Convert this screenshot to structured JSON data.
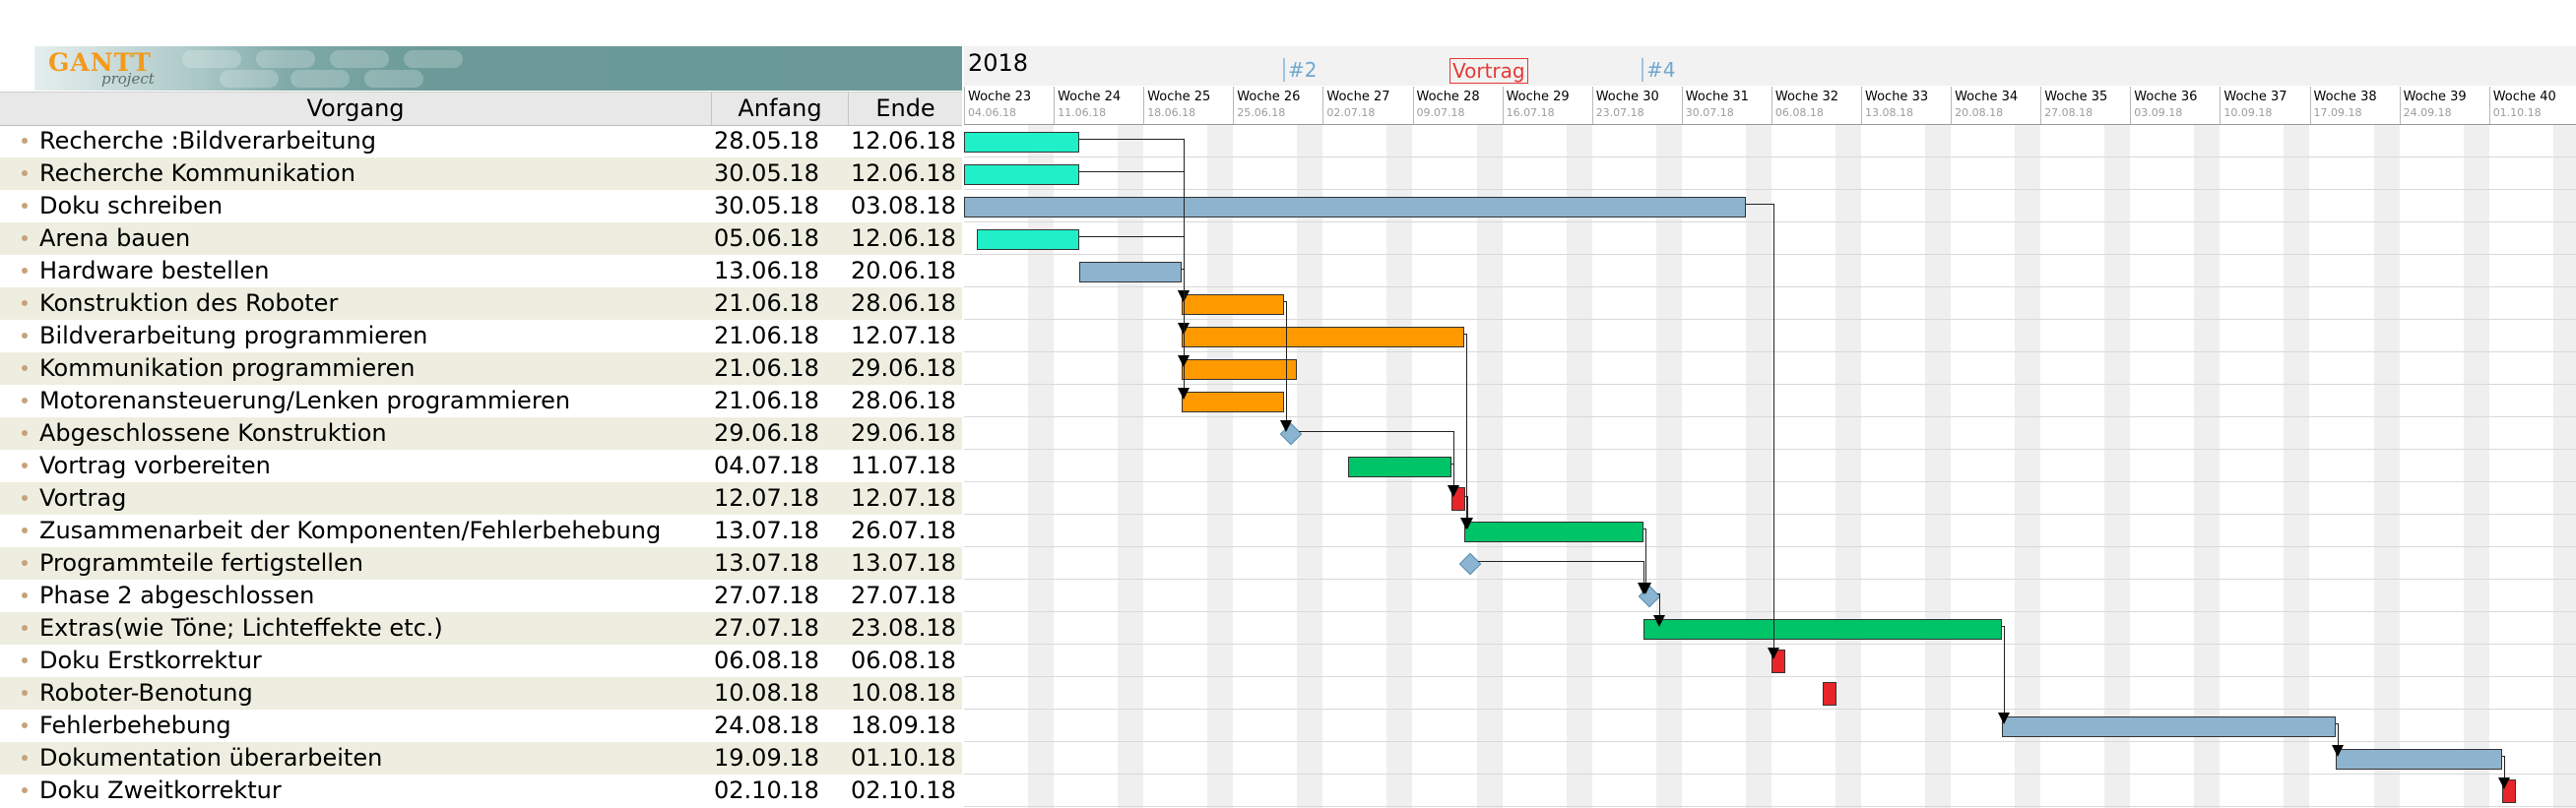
{
  "logo": {
    "text": "GANTT",
    "sub": "project"
  },
  "table": {
    "headers": {
      "name": "Vorgang",
      "start": "Anfang",
      "end": "Ende"
    },
    "tasks": [
      {
        "name": "Recherche :Bildverarbeitung",
        "start": "28.05.18",
        "end": "12.06.18"
      },
      {
        "name": "Recherche Kommunikation",
        "start": "30.05.18",
        "end": "12.06.18"
      },
      {
        "name": "Doku schreiben",
        "start": "30.05.18",
        "end": "03.08.18"
      },
      {
        "name": "Arena bauen",
        "start": "05.06.18",
        "end": "12.06.18"
      },
      {
        "name": "Hardware bestellen",
        "start": "13.06.18",
        "end": "20.06.18"
      },
      {
        "name": "Konstruktion des Roboter",
        "start": "21.06.18",
        "end": "28.06.18"
      },
      {
        "name": "Bildverarbeitung programmieren",
        "start": "21.06.18",
        "end": "12.07.18"
      },
      {
        "name": "Kommunikation programmieren",
        "start": "21.06.18",
        "end": "29.06.18"
      },
      {
        "name": "Motorenansteuerung/Lenken programmieren",
        "start": "21.06.18",
        "end": "28.06.18"
      },
      {
        "name": "Abgeschlossene Konstruktion",
        "start": "29.06.18",
        "end": "29.06.18"
      },
      {
        "name": "Vortrag vorbereiten",
        "start": "04.07.18",
        "end": "11.07.18"
      },
      {
        "name": "Vortrag",
        "start": "12.07.18",
        "end": "12.07.18"
      },
      {
        "name": "Zusammenarbeit der Komponenten/Fehlerbehebung",
        "start": "13.07.18",
        "end": "26.07.18"
      },
      {
        "name": "Programmteile fertigstellen",
        "start": "13.07.18",
        "end": "13.07.18"
      },
      {
        "name": "Phase 2 abgeschlossen",
        "start": "27.07.18",
        "end": "27.07.18"
      },
      {
        "name": "Extras(wie Töne; Lichteffekte etc.)",
        "start": "27.07.18",
        "end": "23.08.18"
      },
      {
        "name": "Doku  Erstkorrektur",
        "start": "06.08.18",
        "end": "06.08.18"
      },
      {
        "name": "Roboter-Benotung",
        "start": "10.08.18",
        "end": "10.08.18"
      },
      {
        "name": "Fehlerbehebung",
        "start": "24.08.18",
        "end": "18.09.18"
      },
      {
        "name": "Dokumentation überarbeiten",
        "start": "19.09.18",
        "end": "01.10.18"
      },
      {
        "name": "Doku Zweitkorrektur",
        "start": "02.10.18",
        "end": "02.10.18"
      }
    ]
  },
  "chart": {
    "year": "2018",
    "markers": [
      {
        "label": "#2",
        "color": "#6fa7cf",
        "box": "#9ec3df"
      },
      {
        "label": "Vortrag",
        "color": "#e53935",
        "box": "#e53935"
      },
      {
        "label": "#4",
        "color": "#6fa7cf",
        "box": "#9ec3df"
      }
    ],
    "weeks": [
      {
        "name": "Woche 23",
        "date": "04.06.18"
      },
      {
        "name": "Woche 24",
        "date": "11.06.18"
      },
      {
        "name": "Woche 25",
        "date": "18.06.18"
      },
      {
        "name": "Woche 26",
        "date": "25.06.18"
      },
      {
        "name": "Woche 27",
        "date": "02.07.18"
      },
      {
        "name": "Woche 28",
        "date": "09.07.18"
      },
      {
        "name": "Woche 29",
        "date": "16.07.18"
      },
      {
        "name": "Woche 30",
        "date": "23.07.18"
      },
      {
        "name": "Woche 31",
        "date": "30.07.18"
      },
      {
        "name": "Woche 32",
        "date": "06.08.18"
      },
      {
        "name": "Woche 33",
        "date": "13.08.18"
      },
      {
        "name": "Woche 34",
        "date": "20.08.18"
      },
      {
        "name": "Woche 35",
        "date": "27.08.18"
      },
      {
        "name": "Woche 36",
        "date": "03.09.18"
      },
      {
        "name": "Woche 37",
        "date": "10.09.18"
      },
      {
        "name": "Woche 38",
        "date": "17.09.18"
      },
      {
        "name": "Woche 39",
        "date": "24.09.18"
      },
      {
        "name": "Woche 40",
        "date": "01.10.18"
      }
    ],
    "colors": {
      "research": "#1ff0c8",
      "plan": "#8db3cf",
      "build": "#ff9900",
      "green": "#00c468",
      "red": "#e8262a",
      "milestone": "#8ab4d2"
    },
    "bar_styles": [
      "research",
      "research",
      "plan",
      "research",
      "plan",
      "build",
      "build",
      "build",
      "build",
      "milestone",
      "green",
      "red",
      "green",
      "milestone",
      "milestone",
      "green",
      "red",
      "red",
      "plan",
      "plan",
      "red"
    ],
    "dependencies": [
      [
        0,
        5
      ],
      [
        1,
        5
      ],
      [
        3,
        8
      ],
      [
        4,
        5
      ],
      [
        4,
        6
      ],
      [
        4,
        7
      ],
      [
        5,
        9
      ],
      [
        6,
        12
      ],
      [
        11,
        12
      ],
      [
        12,
        14
      ],
      [
        9,
        11
      ],
      [
        10,
        11
      ],
      [
        13,
        14
      ],
      [
        14,
        15
      ],
      [
        2,
        16
      ],
      [
        15,
        18
      ],
      [
        18,
        19
      ],
      [
        19,
        20
      ]
    ]
  }
}
